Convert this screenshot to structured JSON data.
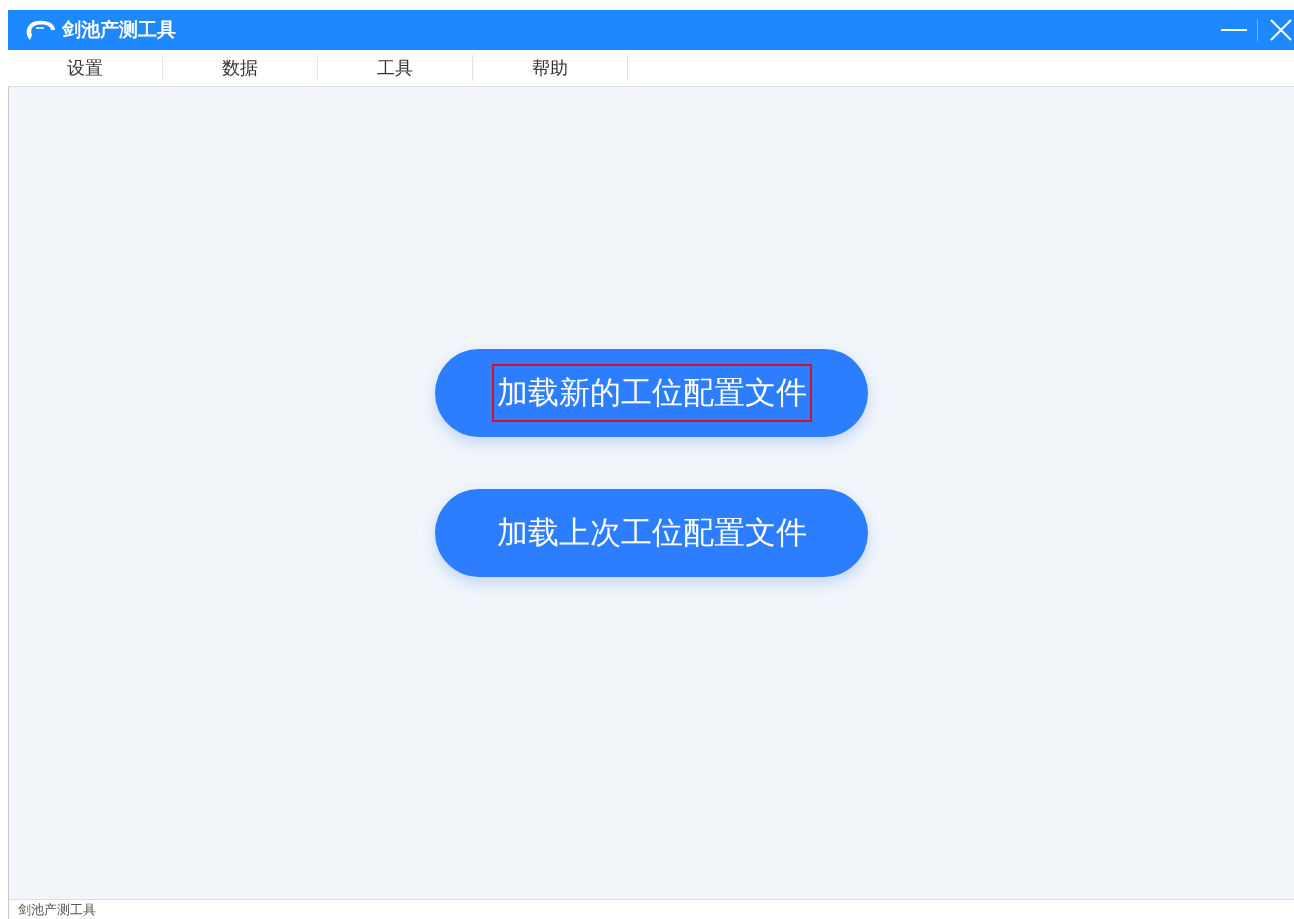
{
  "window": {
    "title": "剑池产测工具"
  },
  "menu": [
    {
      "label": "设置"
    },
    {
      "label": "数据"
    },
    {
      "label": "工具"
    },
    {
      "label": "帮助"
    }
  ],
  "buttons": [
    {
      "label": "加载新的工位配置文件",
      "focused": true
    },
    {
      "label": "加载上次工位配置文件",
      "focused": false
    }
  ],
  "status_bar": {
    "text": "剑池产测工具"
  }
}
